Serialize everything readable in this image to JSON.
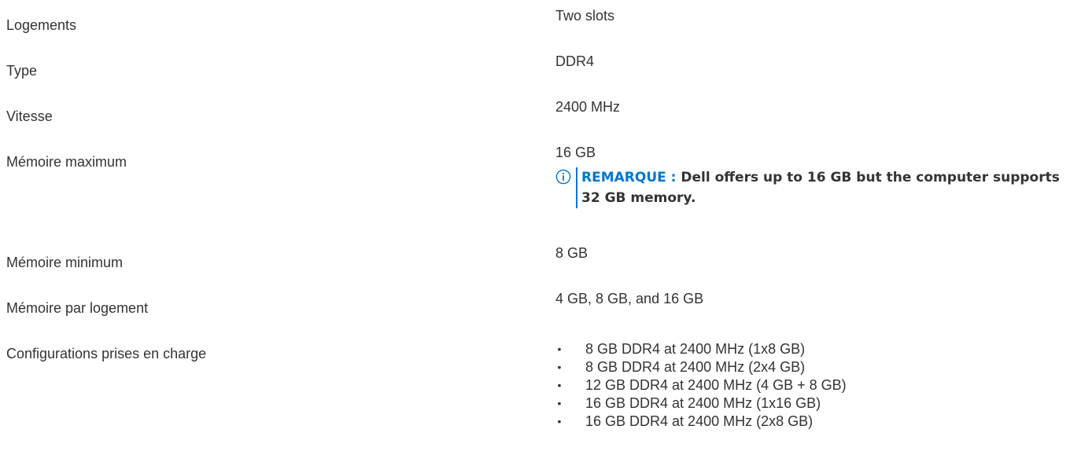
{
  "specs": {
    "slots": {
      "label": "Logements",
      "value": "Two slots"
    },
    "type": {
      "label": "Type",
      "value": "DDR4"
    },
    "speed": {
      "label": "Vitesse",
      "value": "2400 MHz"
    },
    "max_memory": {
      "label": "Mémoire maximum",
      "value": "16 GB",
      "note": {
        "label": "REMARQUE :",
        "text": "Dell offers up to 16 GB but the computer supports 32 GB memory.",
        "icon": "info-icon",
        "accent_color": "#0076ce"
      }
    },
    "min_memory": {
      "label": "Mémoire minimum",
      "value": "8 GB"
    },
    "per_slot": {
      "label": "Mémoire par logement",
      "value": "4 GB, 8 GB, and 16 GB"
    },
    "configurations": {
      "label": "Configurations prises en charge",
      "items": [
        "8 GB DDR4 at 2400 MHz (1x8 GB)",
        "8 GB DDR4 at 2400 MHz (2x4 GB)",
        "12 GB DDR4 at 2400 MHz (4 GB + 8 GB)",
        "16 GB DDR4 at 2400 MHz (1x16 GB)",
        "16 GB DDR4 at 2400 MHz (2x8 GB)"
      ],
      "bullet": "•"
    }
  },
  "colors": {
    "text": "#333333",
    "accent": "#0076ce"
  }
}
